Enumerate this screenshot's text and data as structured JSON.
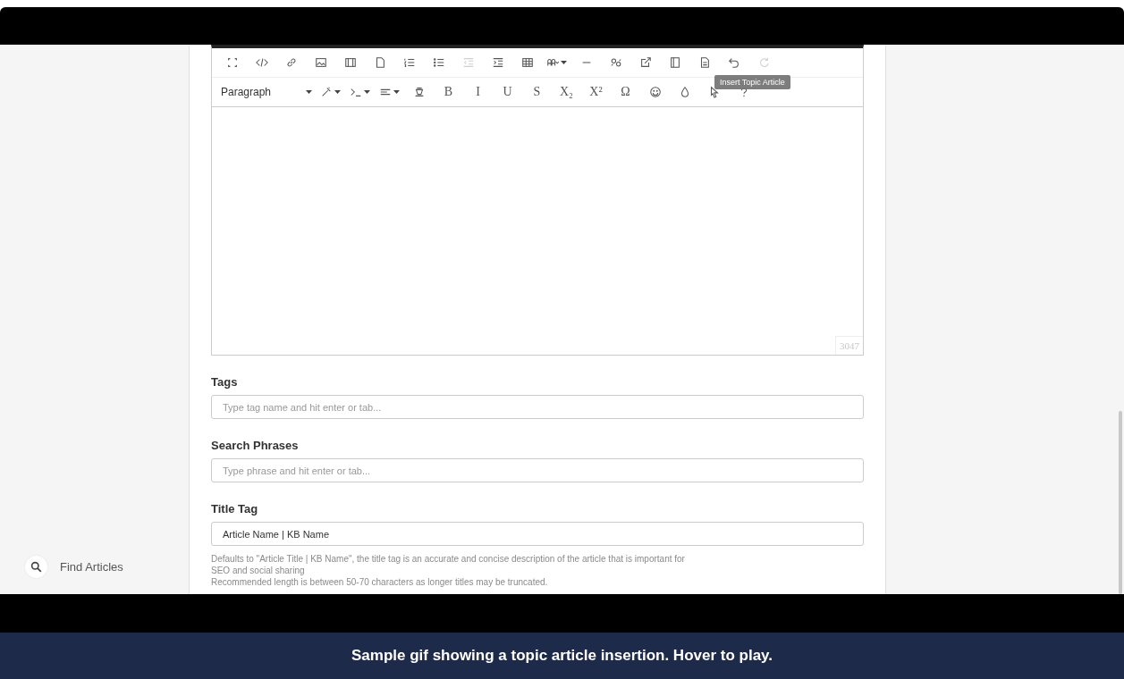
{
  "editor": {
    "toolbar_row_1": [
      {
        "kind": "fullscreen",
        "disabled": false
      },
      {
        "kind": "code",
        "disabled": false
      },
      {
        "kind": "link",
        "disabled": false
      },
      {
        "kind": "image",
        "disabled": false
      },
      {
        "kind": "media",
        "disabled": false
      },
      {
        "kind": "page",
        "disabled": false
      },
      {
        "kind": "numlist",
        "disabled": false
      },
      {
        "kind": "bullist",
        "disabled": false
      },
      {
        "kind": "outdent",
        "disabled": true
      },
      {
        "kind": "indent",
        "disabled": false
      },
      {
        "kind": "table",
        "disabled": false
      },
      {
        "kind": "charmap",
        "disabled": false
      },
      {
        "kind": "hr",
        "disabled": false
      },
      {
        "kind": "replace",
        "disabled": false
      },
      {
        "kind": "external",
        "disabled": false
      },
      {
        "kind": "template",
        "disabled": false
      },
      {
        "kind": "document",
        "disabled": false
      },
      {
        "kind": "undo",
        "disabled": false
      },
      {
        "kind": "redo",
        "disabled": true
      }
    ],
    "block_format": "Paragraph",
    "toolbar_row_2": [
      {
        "kind": "format"
      },
      {
        "kind": "terminal"
      },
      {
        "kind": "align"
      },
      {
        "kind": "clear"
      },
      {
        "kind": "text",
        "label": "B"
      },
      {
        "kind": "text",
        "label": "I"
      },
      {
        "kind": "text",
        "label": "U"
      },
      {
        "kind": "text",
        "label": "S"
      },
      {
        "kind": "text",
        "label": "X₂"
      },
      {
        "kind": "text",
        "label": "X²"
      },
      {
        "kind": "text",
        "label": "Ω"
      },
      {
        "kind": "emoji"
      },
      {
        "kind": "drop"
      },
      {
        "kind": "cursor"
      },
      {
        "kind": "help"
      }
    ],
    "tooltip": "Insert Topic Article",
    "char_count": "3047"
  },
  "fields": [
    {
      "label": "Tags",
      "placeholder": "Type tag name and hit enter or tab..."
    },
    {
      "label": "Search Phrases",
      "placeholder": "Type phrase and hit enter or tab..."
    },
    {
      "label": "Title Tag",
      "value": "Article Name | KB Name"
    }
  ],
  "help_lines": [
    "Defaults to \"Article Title | KB Name\", the title tag is an accurate and concise description of the article that is important for",
    "SEO and social sharing",
    "Recommended length is between 50-70 characters as longer titles may be truncated."
  ],
  "sidebar": {
    "find_label": "Find Articles"
  },
  "caption": "Sample gif showing a topic article insertion. Hover to play."
}
